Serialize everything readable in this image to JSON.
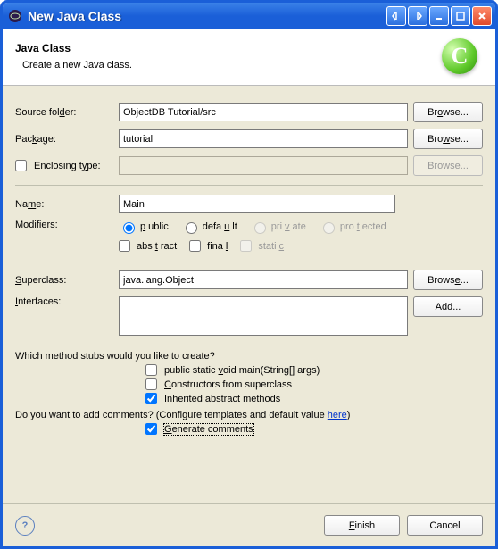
{
  "window": {
    "title": "New Java Class"
  },
  "banner": {
    "title": "Java Class",
    "subtitle": "Create a new Java class.",
    "iconLetter": "C"
  },
  "sourceFolder": {
    "label": "Source folder:",
    "value": "ObjectDB Tutorial/src",
    "browse": "Browse..."
  },
  "package": {
    "label": "Package:",
    "value": "tutorial",
    "browse": "Browse..."
  },
  "enclosingType": {
    "label": "Enclosing type:",
    "checked": false,
    "value": "",
    "browse": "Browse..."
  },
  "name": {
    "label": "Name:",
    "value": "Main"
  },
  "modifiers": {
    "label": "Modifiers:",
    "access": {
      "public": "public",
      "default": "default",
      "private": "private",
      "protected": "protected",
      "selected": "public"
    },
    "abstract": "abstract",
    "final": "final",
    "static": "static",
    "abstractChecked": false,
    "finalChecked": false,
    "staticChecked": false
  },
  "superclass": {
    "label": "Superclass:",
    "value": "java.lang.Object",
    "browse": "Browse..."
  },
  "interfaces": {
    "label": "Interfaces:",
    "add": "Add..."
  },
  "methodStubs": {
    "question": "Which method stubs would you like to create?",
    "main": "public static void main(String[] args)",
    "mainChecked": false,
    "constructors": "Constructors from superclass",
    "constructorsChecked": false,
    "inherited": "Inherited abstract methods",
    "inheritedChecked": true
  },
  "comments": {
    "question_pre": "Do you want to add comments? (Configure templates and default value ",
    "link": "here",
    "question_post": ")",
    "generate": "Generate comments",
    "generateChecked": true
  },
  "footer": {
    "finish": "Finish",
    "cancel": "Cancel"
  }
}
